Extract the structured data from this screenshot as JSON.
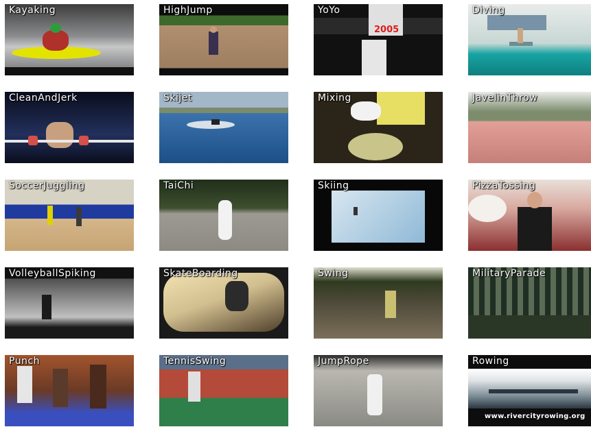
{
  "tiles": [
    {
      "label": "Kayaking",
      "palette": [
        "#1b1b1b",
        "#6e6f70",
        "#e3e300",
        "#2e9c3e"
      ]
    },
    {
      "label": "HighJump",
      "palette": [
        "#0d0d0d",
        "#b08f6f",
        "#3d6a2c",
        "#39304f"
      ]
    },
    {
      "label": "YoYo",
      "palette": [
        "#111111",
        "#4b4b4b",
        "#e01b1b",
        "#f0f0f0"
      ]
    },
    {
      "label": "Diving",
      "palette": [
        "#c7d7d3",
        "#17a4a3",
        "#e0e7e8",
        "#6d8c94"
      ]
    },
    {
      "label": "CleanAndJerk",
      "palette": [
        "#0a0d1c",
        "#22305c",
        "#c8a080",
        "#e8e8e8"
      ]
    },
    {
      "label": "Skijet",
      "palette": [
        "#3c73ad",
        "#1c4f86",
        "#a3b7c8",
        "#f5f5f5"
      ]
    },
    {
      "label": "Mixing",
      "palette": [
        "#2b2418",
        "#e6df64",
        "#f2f2f2",
        "#5f5a4d"
      ]
    },
    {
      "label": "JavelinThrow",
      "palette": [
        "#c67f7a",
        "#e1a097",
        "#7c8c6c",
        "#f0eee8"
      ]
    },
    {
      "label": "SoccerJuggling",
      "palette": [
        "#d4b689",
        "#1f3b9f",
        "#d6d2c4",
        "#3a3a3a"
      ]
    },
    {
      "label": "TaiChi",
      "palette": [
        "#1f2f1a",
        "#9d9a92",
        "#f2f2f2",
        "#3f4f2f"
      ]
    },
    {
      "label": "Skiing",
      "palette": [
        "#080808",
        "#8fb9d7",
        "#d7e6ef",
        "#333333"
      ]
    },
    {
      "label": "PizzaTossing",
      "palette": [
        "#8a3030",
        "#d9a9a0",
        "#1a1a1a",
        "#e8e0d8"
      ]
    },
    {
      "label": "VolleyballSpiking",
      "palette": [
        "#111111",
        "#505050",
        "#c0c0c0",
        "#1a1a1a"
      ]
    },
    {
      "label": "SkateBoarding",
      "palette": [
        "#4f3f2a",
        "#d2bf90",
        "#1a1a1a",
        "#f1e1b1"
      ]
    },
    {
      "label": "Swing",
      "palette": [
        "#4f4b3a",
        "#7b6f5a",
        "#2f3a1f",
        "#e0e0d0"
      ]
    },
    {
      "label": "MilitaryParade",
      "palette": [
        "#1f2f23",
        "#5c6b55",
        "#2b3726",
        "#c8c8c8"
      ]
    },
    {
      "label": "Punch",
      "palette": [
        "#1c1c24",
        "#a2542d",
        "#3a4fbf",
        "#e6e6e6"
      ]
    },
    {
      "label": "TennisSwing",
      "palette": [
        "#2e7f4a",
        "#b44a39",
        "#e0e0e0",
        "#5a6f8a"
      ]
    },
    {
      "label": "JumpRope",
      "palette": [
        "#2b2b2b",
        "#b9b7b0",
        "#8a8a84",
        "#f0f0f0"
      ]
    },
    {
      "label": "Rowing",
      "palette": [
        "#ffffff",
        "#7a8a93",
        "#2b3740",
        "#0d0d0d"
      ]
    }
  ],
  "footer_text": "www.rivercityrowing.org",
  "yoyo_banner": "2005"
}
